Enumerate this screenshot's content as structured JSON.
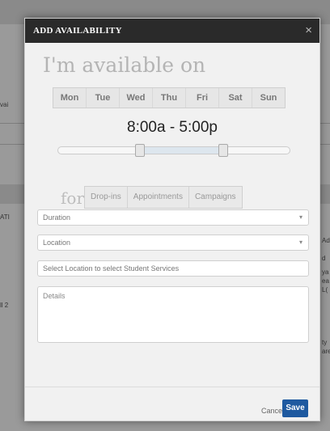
{
  "background": {
    "fragments": [
      "ATI",
      "vai",
      "ll 2",
      "Ad",
      "d",
      "ya",
      "ea",
      "L(",
      "ty",
      "are"
    ]
  },
  "modal": {
    "title": "ADD AVAILABILITY",
    "close_glyph": "×",
    "headline": "I'm available on",
    "days": [
      "Mon",
      "Tue",
      "Wed",
      "Thu",
      "Fri",
      "Sat",
      "Sun"
    ],
    "time_range": "8:00a - 5:00p",
    "slider": {
      "start_fraction": 0.35,
      "end_fraction": 0.71
    },
    "for_label": "for",
    "types": [
      "Drop-ins",
      "Appointments",
      "Campaigns"
    ],
    "duration_placeholder": "Duration",
    "location_placeholder": "Location",
    "services_placeholder": "Select Location to select Student Services",
    "details_placeholder": "Details",
    "caret_glyph": "▾",
    "cancel_label": "Cancel",
    "save_label": "Save",
    "colors": {
      "header": "#2a2a2a",
      "save": "#1f5aa0",
      "panel": "#f1f1f1"
    }
  }
}
